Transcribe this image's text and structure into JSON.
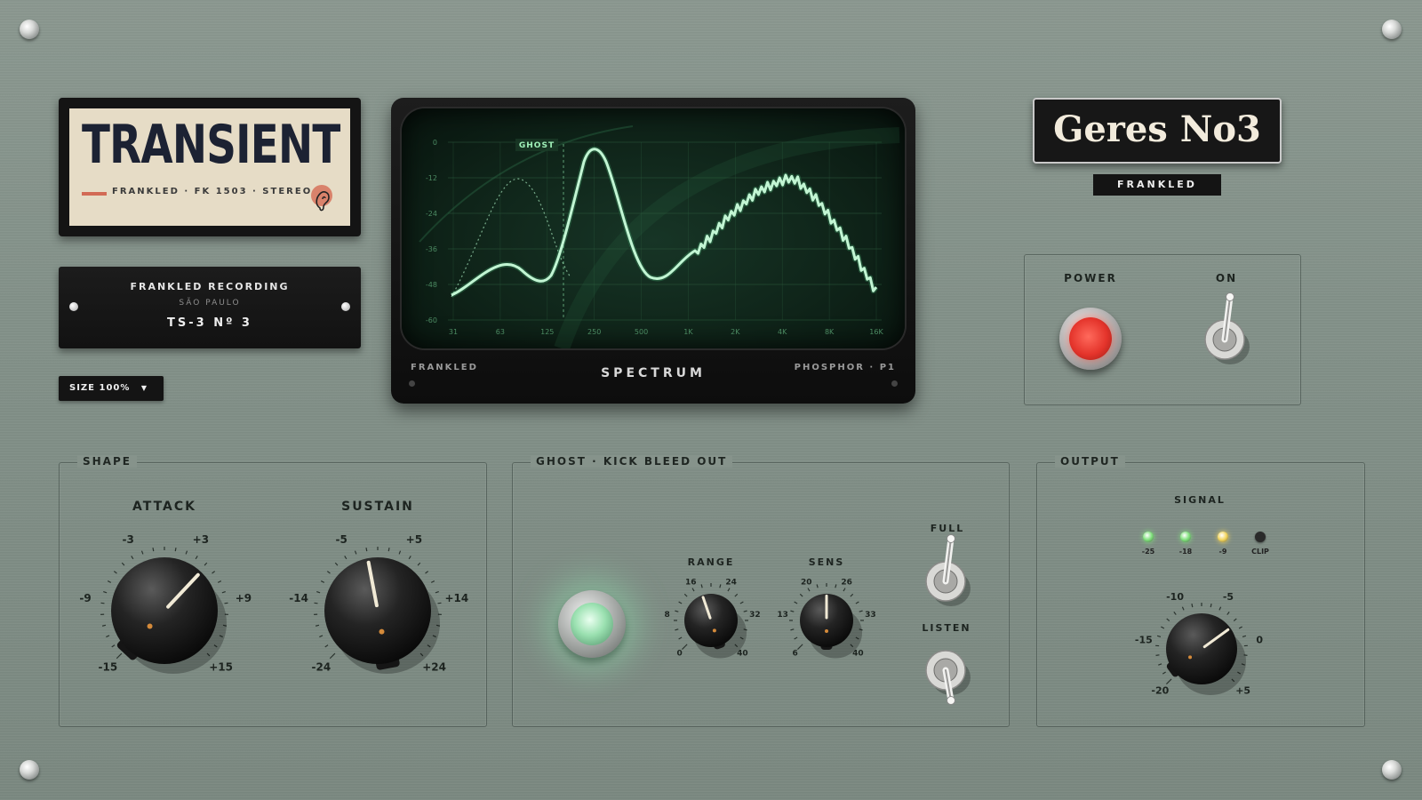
{
  "logo": {
    "title": "TRANSIENT",
    "subtitle": "FRANKLED · FK 1503 · STEREO"
  },
  "plate": {
    "line1": "FRANKLED RECORDING",
    "line2": "SÃO PAULO",
    "line3": "TS-3  Nº 3"
  },
  "size_dropdown": {
    "label": "SIZE 100%",
    "arrow": "▼"
  },
  "monitor": {
    "brand": "FRANKLED",
    "title": "SPECTRUM",
    "phosphor": "PHOSPHOR · P1",
    "ghost_tag": "GHOST",
    "db_ticks": [
      "0",
      "-12",
      "-24",
      "-36",
      "-48",
      "-60"
    ],
    "freq_ticks": [
      "31",
      "63",
      "125",
      "250",
      "500",
      "1K",
      "2K",
      "4K",
      "8K",
      "16K"
    ],
    "trace_color": "#bff5cf"
  },
  "brand": {
    "title": "Geres No3",
    "maker": "FRANKLED"
  },
  "power": {
    "power_label": "POWER",
    "on_label": "ON",
    "button_color": "#e4342b",
    "toggle_state": "up"
  },
  "shape": {
    "label": "SHAPE",
    "attack": {
      "label": "ATTACK",
      "scale": [
        "-15",
        "-9",
        "-3",
        "+3",
        "+9",
        "+15"
      ],
      "position": 0.66
    },
    "sustain": {
      "label": "SUSTAIN",
      "scale": [
        "-24",
        "-14",
        "-5",
        "+5",
        "+14",
        "+24"
      ],
      "position": 0.46
    }
  },
  "ghost": {
    "label": "GHOST · KICK BLEED OUT",
    "range": {
      "label": "RANGE",
      "scale": [
        "0",
        "8",
        "16",
        "24",
        "32",
        "40"
      ],
      "position": 0.43
    },
    "sens": {
      "label": "SENS",
      "scale": [
        "6",
        "13",
        "20",
        "26",
        "33",
        "40"
      ],
      "position": 0.5
    },
    "full_label": "FULL",
    "listen_label": "LISTEN",
    "full_toggle_state": "up",
    "listen_toggle_state": "down",
    "led_color": "#9ae0b0"
  },
  "output": {
    "label": "OUTPUT",
    "signal_label": "SIGNAL",
    "meters": [
      {
        "label": "-25",
        "color": "#7ee07a",
        "lit": true
      },
      {
        "label": "-18",
        "color": "#7ee07a",
        "lit": true
      },
      {
        "label": "-9",
        "color": "#f2d45a",
        "lit": true
      },
      {
        "label": "CLIP",
        "color": "#2a2a2a",
        "lit": false
      }
    ],
    "knob": {
      "scale": [
        "-20",
        "-15",
        "-10",
        "-5",
        "0",
        "+5"
      ],
      "position": 0.7
    }
  }
}
